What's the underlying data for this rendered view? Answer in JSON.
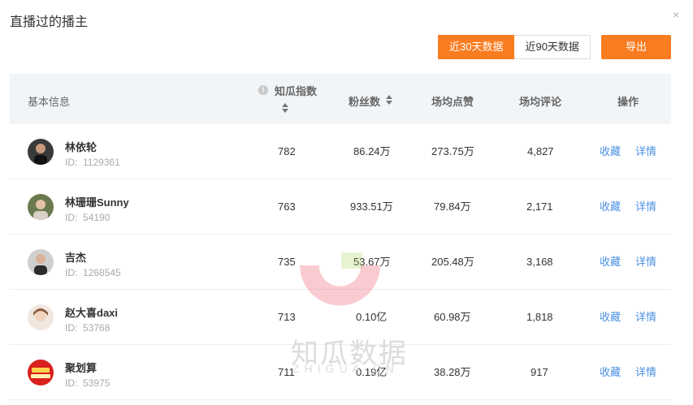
{
  "dialog": {
    "title": "直播过的播主",
    "close_label": "×"
  },
  "range": {
    "options": [
      "近30天数据",
      "近90天数据"
    ],
    "selected": 0
  },
  "export_label": "导出",
  "columns": {
    "basic": "基本信息",
    "index": "知瓜指数",
    "fans": "粉丝数",
    "likes": "场均点赞",
    "comments": "场均评论",
    "actions": "操作"
  },
  "id_prefix": "ID:",
  "action_labels": {
    "favorite": "收藏",
    "detail": "详情"
  },
  "rows": [
    {
      "name": "林依轮",
      "id": "1129361",
      "index": "782",
      "fans": "86.24万",
      "likes": "273.75万",
      "comments": "4,827",
      "favorite": "收藏",
      "detail": "详情"
    },
    {
      "name": "林珊珊Sunny",
      "id": "54190",
      "index": "763",
      "fans": "933.51万",
      "likes": "79.84万",
      "comments": "2,171",
      "favorite": "收藏",
      "detail": "详情"
    },
    {
      "name": "吉杰",
      "id": "1268545",
      "index": "735",
      "fans": "53.67万",
      "likes": "205.48万",
      "comments": "3,168",
      "favorite": "收藏",
      "detail": "详情"
    },
    {
      "name": "赵大喜daxi",
      "id": "53768",
      "index": "713",
      "fans": "0.10亿",
      "likes": "60.98万",
      "comments": "1,818",
      "favorite": "收藏",
      "detail": "详情"
    },
    {
      "name": "聚划算",
      "id": "53975",
      "index": "711",
      "fans": "0.19亿",
      "likes": "38.28万",
      "comments": "917",
      "favorite": "收藏",
      "detail": "详情"
    }
  ],
  "watermark": {
    "main": "知瓜数据",
    "sub": "ZHIGUA.CN"
  },
  "colors": {
    "accent": "#fa7c20",
    "link": "#4a90e2",
    "header_bg": "#f2f5f8"
  }
}
